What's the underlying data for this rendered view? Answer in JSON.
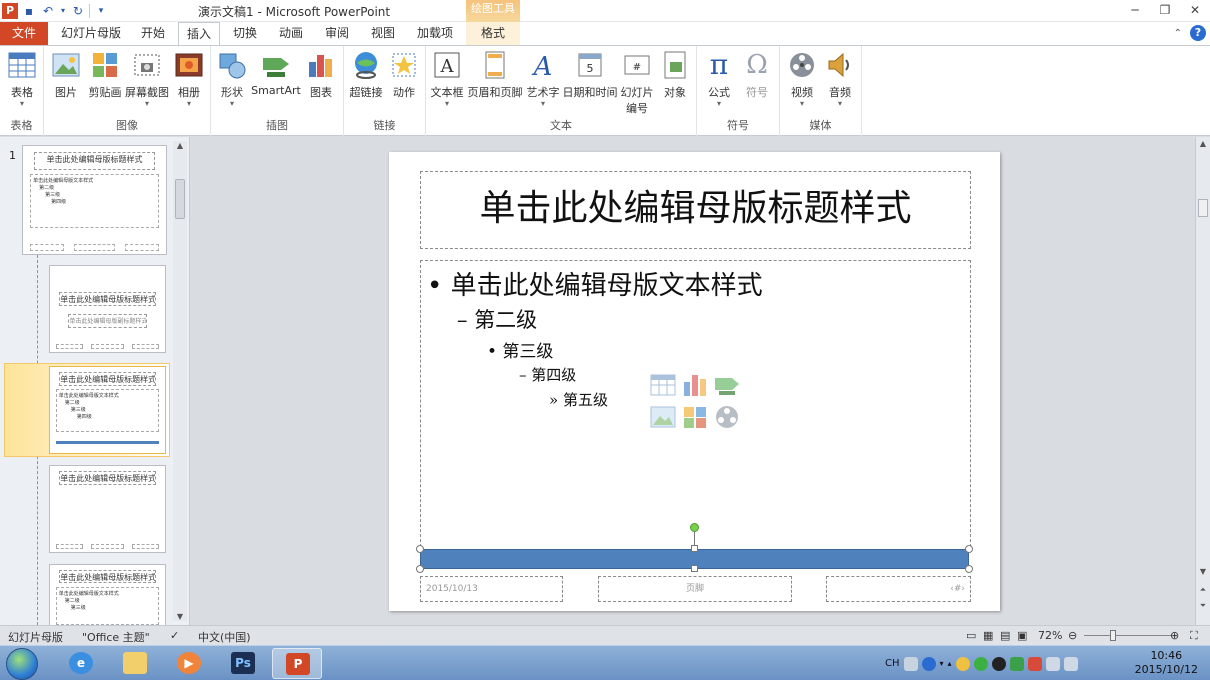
{
  "window": {
    "title": "演示文稿1 - Microsoft PowerPoint",
    "context_tab_header": "绘图工具"
  },
  "tabs": [
    {
      "label": "文件"
    },
    {
      "label": "幻灯片母版"
    },
    {
      "label": "开始"
    },
    {
      "label": "插入"
    },
    {
      "label": "切换"
    },
    {
      "label": "动画"
    },
    {
      "label": "审阅"
    },
    {
      "label": "视图"
    },
    {
      "label": "加载项"
    },
    {
      "label": "格式"
    }
  ],
  "ribbon": {
    "groups": {
      "table": "表格",
      "image": "图像",
      "illustration": "插图",
      "links": "链接",
      "text": "文本",
      "symbols": "符号",
      "media": "媒体"
    },
    "buttons": {
      "table": "表格",
      "picture": "图片",
      "clipart": "剪贴画",
      "screenshot": "屏幕截图",
      "album": "相册",
      "shapes": "形状",
      "smartart": "SmartArt",
      "chart": "图表",
      "hyperlink": "超链接",
      "action": "动作",
      "textbox": "文本框",
      "header_footer": "页眉和页脚",
      "wordart": "艺术字",
      "datetime": "日期和时间",
      "slide_number_1": "幻灯片",
      "slide_number_2": "编号",
      "object": "对象",
      "equation": "公式",
      "symbol": "符号",
      "video": "视频",
      "audio": "音频"
    }
  },
  "thumbnails": {
    "number": "1",
    "master_title": "单击此处编辑母版标题样式",
    "master_text": "单击此处编辑母版文本样式",
    "level2": "第二级",
    "level3": "第三级",
    "level4": "第四级",
    "subtitle": "单击此处编辑母版副标题样式"
  },
  "slide": {
    "title": "单击此处编辑母版标题样式",
    "levels": [
      "• 单击此处编辑母版文本样式",
      "– 第二级",
      "• 第三级",
      "– 第四级",
      "» 第五级"
    ],
    "date": "2015/10/13",
    "footer": "页脚",
    "number": "‹#›"
  },
  "statusbar": {
    "view": "幻灯片母版",
    "theme": "\"Office 主题\"",
    "language": "中文(中国)",
    "zoom": "72%",
    "zoom_level": 0.72
  },
  "taskbar": {
    "ime": "CH",
    "time": "10:46",
    "date": "2015/10/12"
  },
  "colors": {
    "file_tab": "#d24726",
    "placeholder_bar": "#4f81bd",
    "context_tab": "#f4c27c"
  }
}
